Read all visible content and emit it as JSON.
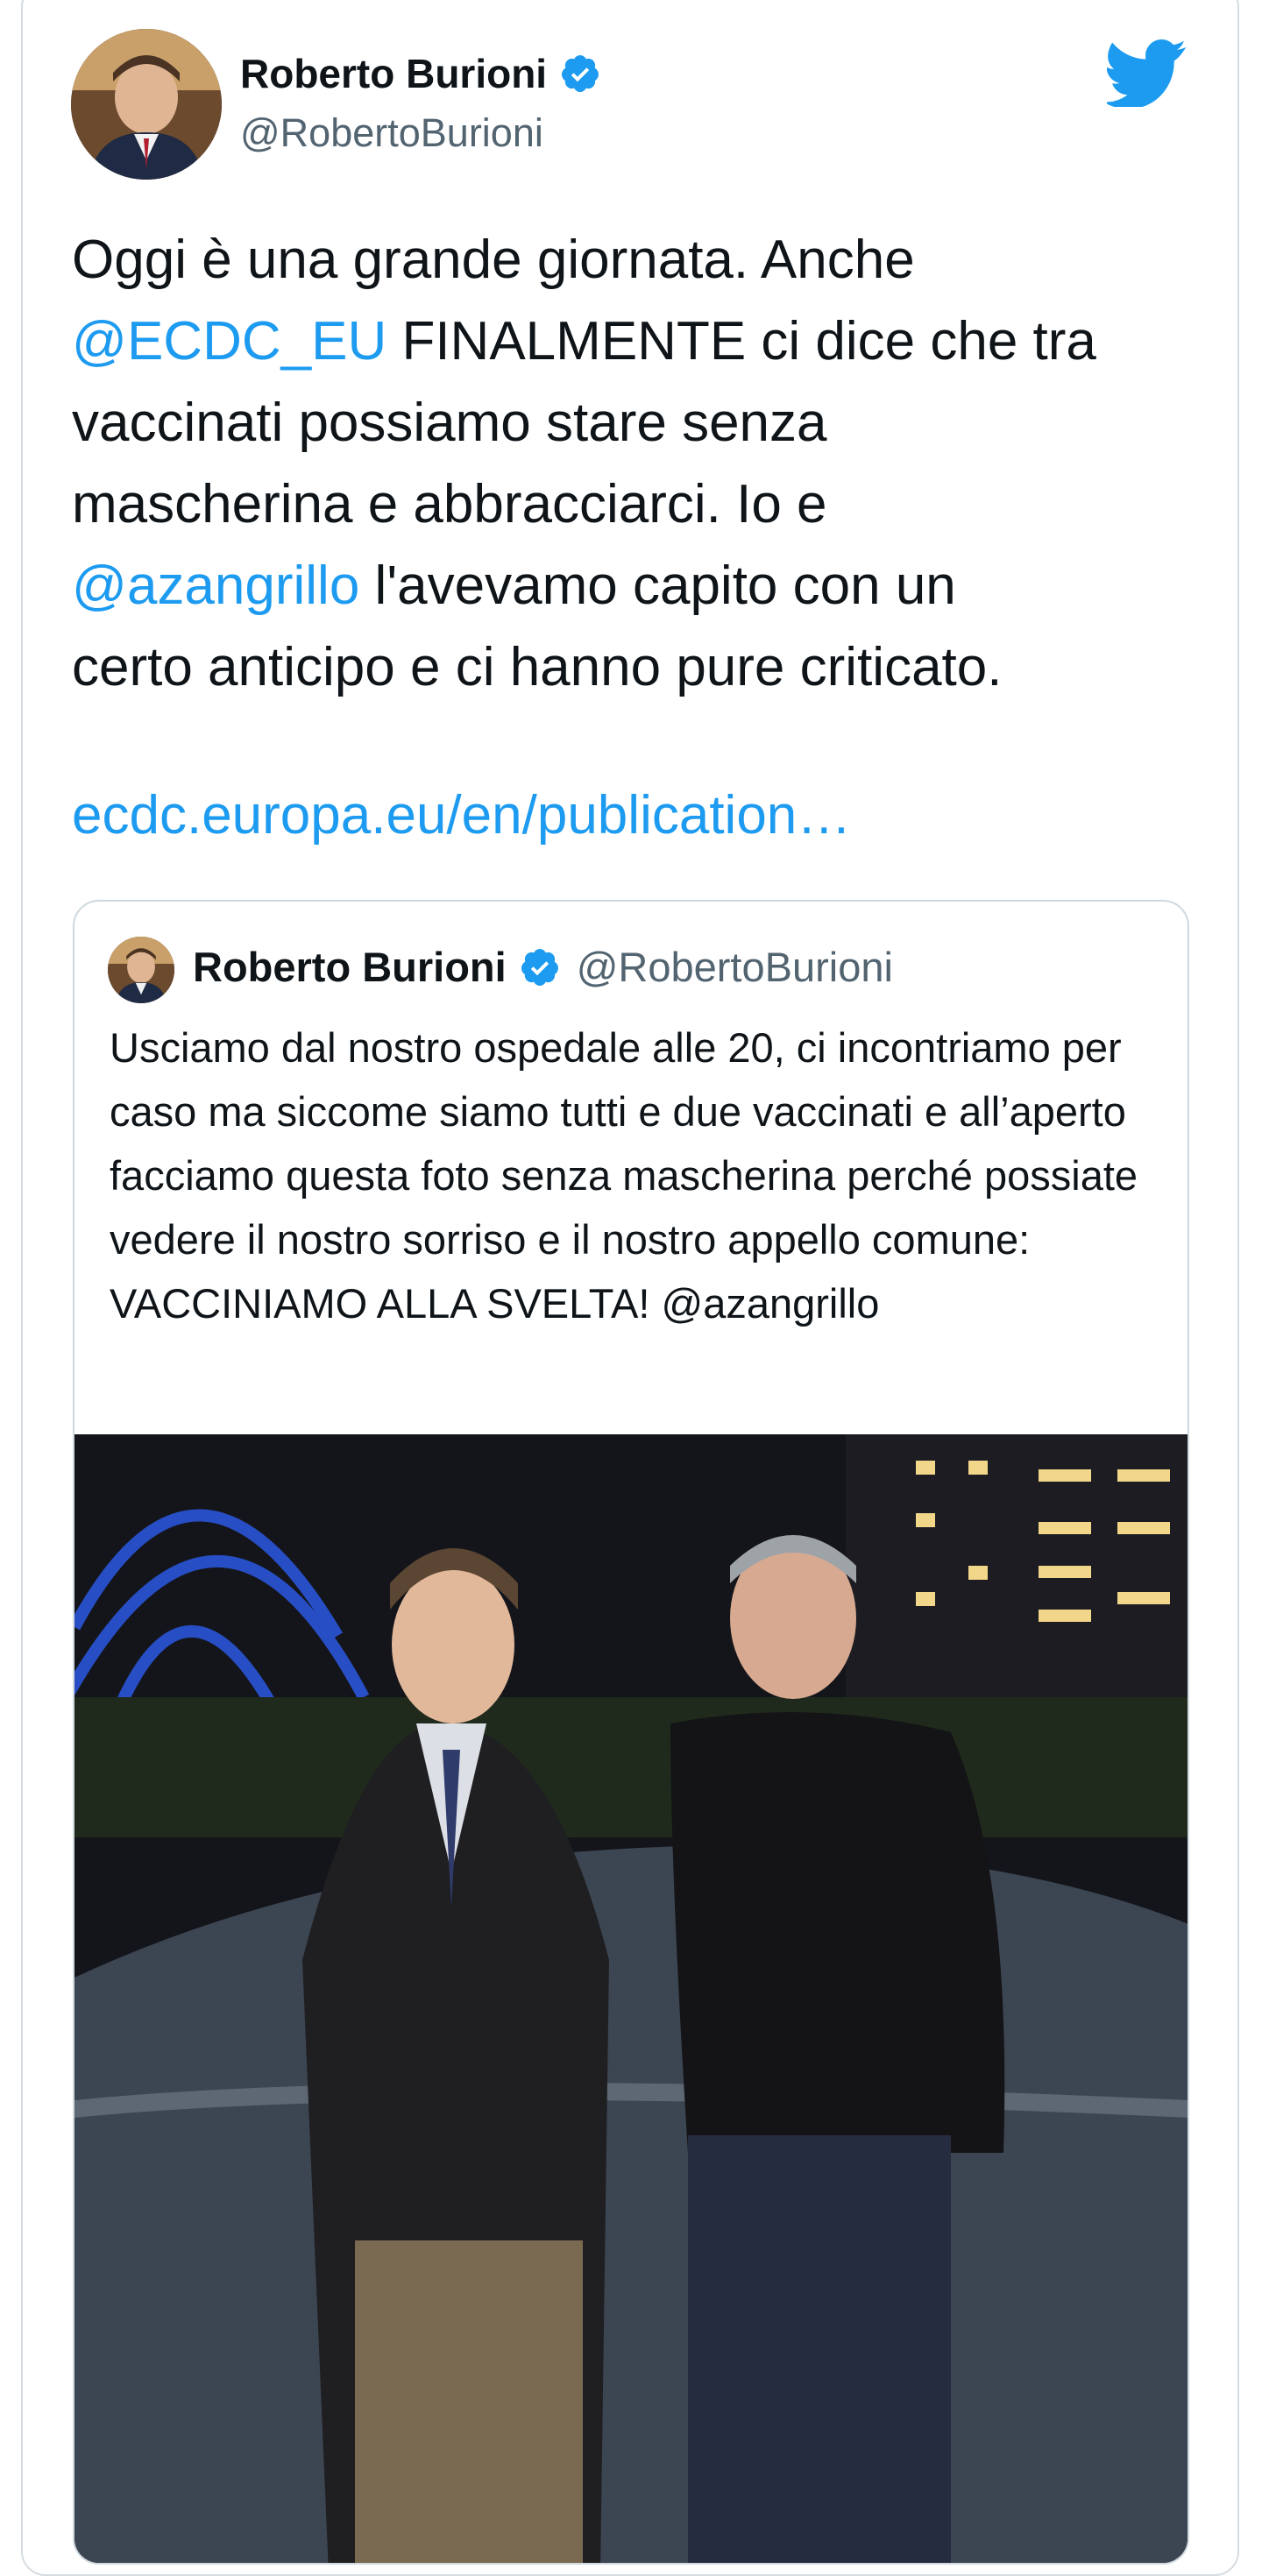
{
  "tweet": {
    "author_name": "Roberto Burioni",
    "author_handle": "@RobertoBurioni",
    "text_part1": "Oggi è una grande giornata. Anche\n",
    "mention1": "@ECDC_EU",
    "text_part2": " FINALMENTE ci dice che tra\nvaccinati possiamo stare senza\nmascherina e abbracciarci. Io e\n",
    "mention2": "@azangrillo",
    "text_part3": " l'avevamo capito con un\ncerto anticipo e ci hanno pure criticato.",
    "link": "ecdc.europa.eu/en/publication…"
  },
  "quoted_tweet": {
    "author_name": "Roberto Burioni",
    "author_handle": "@RobertoBurioni",
    "text": "Usciamo dal nostro ospedale alle 20, ci incontriamo per caso ma siccome siamo tutti e due vaccinati e all’aperto facciamo questa foto senza mascherina perché possiate vedere il nostro sorriso e il nostro appello comune: VACCINIAMO ALLA SVELTA! @azangrillo"
  },
  "icons": {
    "verified": "verified-badge-icon",
    "platform": "twitter-bird-icon"
  },
  "colors": {
    "accent": "#1d9bf0",
    "text": "#0f1419",
    "secondary": "#536471",
    "border": "#cfd9de"
  }
}
